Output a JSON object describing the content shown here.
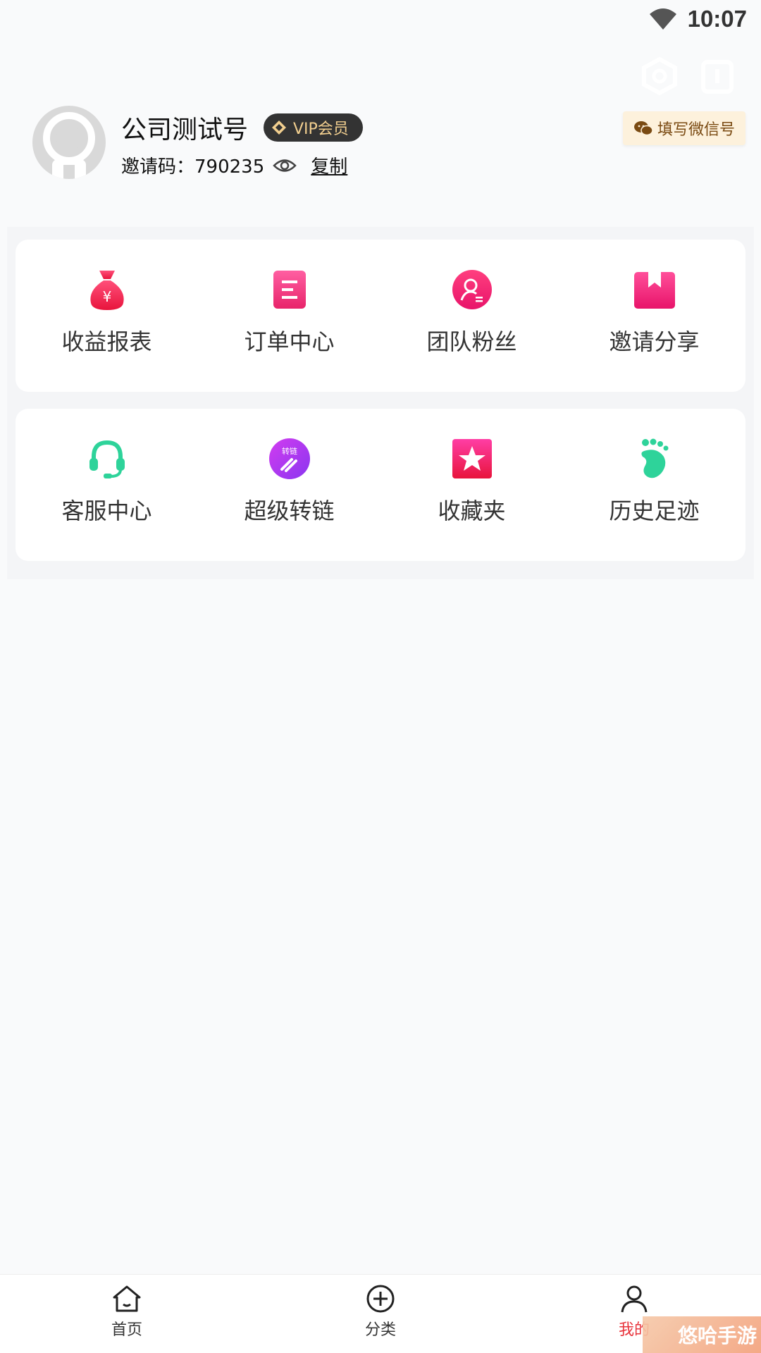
{
  "status_bar": {
    "time": "10:07"
  },
  "profile": {
    "name": "公司测试号",
    "vip_label": "VIP会员",
    "invite_code_text": "邀请码：790235",
    "copy_label": "复制",
    "wechat_button_label": "填写微信号"
  },
  "menu": {
    "row1": [
      {
        "label": "收益报表",
        "icon": "money-bag-icon"
      },
      {
        "label": "订单中心",
        "icon": "order-list-icon"
      },
      {
        "label": "团队粉丝",
        "icon": "team-user-icon"
      },
      {
        "label": "邀请分享",
        "icon": "invite-bookmark-icon"
      }
    ],
    "row2": [
      {
        "label": "客服中心",
        "icon": "headset-icon"
      },
      {
        "label": "超级转链",
        "icon": "link-convert-icon",
        "icon_text": "转链"
      },
      {
        "label": "收藏夹",
        "icon": "star-icon"
      },
      {
        "label": "历史足迹",
        "icon": "footprint-icon"
      }
    ]
  },
  "bottom_nav": [
    {
      "label": "首页",
      "icon": "home-icon"
    },
    {
      "label": "分类",
      "icon": "plus-circle-icon"
    },
    {
      "label": "我的",
      "icon": "user-icon",
      "active": true
    }
  ],
  "colors": {
    "accent_red": "#e8343c",
    "pink": "#e91e63",
    "green": "#2ed39a",
    "purple": "#b23ff0",
    "vip_gold": "#f2cf8f"
  },
  "watermark": {
    "text": "悠哈手游"
  }
}
